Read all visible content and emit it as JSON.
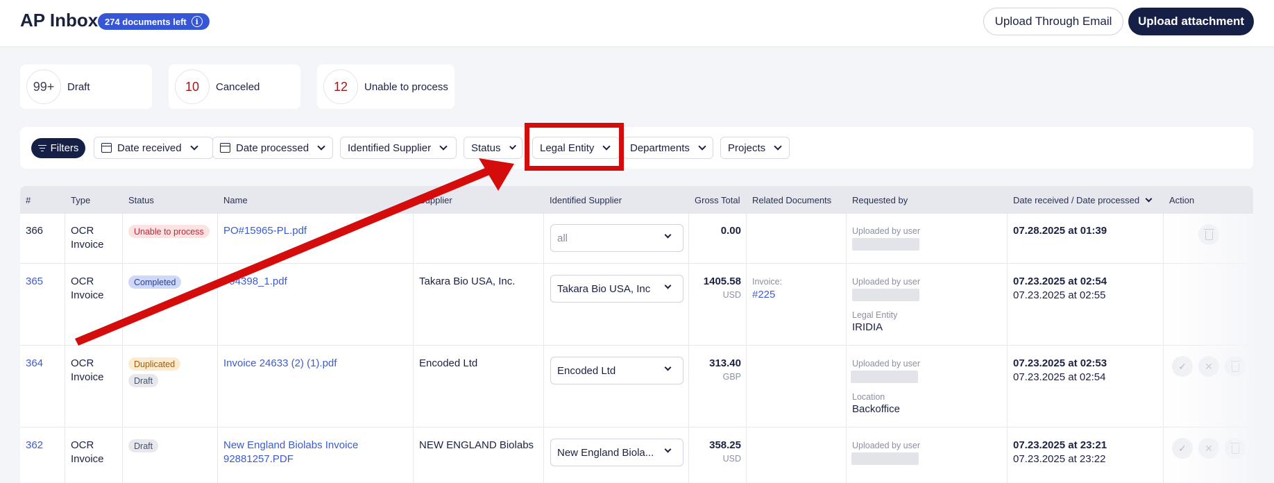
{
  "header": {
    "title": "AP Inbox",
    "docs_badge": "274 documents left",
    "upload_email_label": "Upload Through Email",
    "upload_attachment_label": "Upload attachment"
  },
  "stats": [
    {
      "count": "99+",
      "label": "Draft",
      "color": "#3b3f52"
    },
    {
      "count": "10",
      "label": "Canceled",
      "color": "#a01818"
    },
    {
      "count": "12",
      "label": "Unable to process",
      "color": "#a01818"
    }
  ],
  "filters": {
    "filters_label": "Filters",
    "date_received": "Date received",
    "date_processed": "Date processed",
    "identified_supplier": "Identified Supplier",
    "status": "Status",
    "legal_entity": "Legal Entity",
    "departments": "Departments",
    "projects": "Projects"
  },
  "table": {
    "headers": {
      "num": "#",
      "type": "Type",
      "status": "Status",
      "name": "Name",
      "supplier": "Supplier",
      "identified_supplier": "Identified Supplier",
      "gross_total": "Gross Total",
      "related": "Related Documents",
      "requested_by": "Requested by",
      "dates": "Date received / Date processed",
      "action": "Action"
    },
    "rows": [
      {
        "num": "366",
        "type": "OCR Invoice",
        "status": [
          "Unable to process"
        ],
        "name": "PO#15965-PL.pdf",
        "supplier": "",
        "identified": "all",
        "gross": "0.00",
        "currency": "",
        "related_label": "",
        "related_link": "",
        "requested": "Uploaded by user",
        "extra_label": "",
        "extra_value": "",
        "date_received": "07.28.2025 at 01:39",
        "date_processed": ""
      },
      {
        "num": "365",
        "type": "OCR Invoice",
        "status": [
          "Completed"
        ],
        "name": "794398_1.pdf",
        "supplier": "Takara Bio USA, Inc.",
        "identified": "Takara Bio USA, Inc",
        "gross": "1405.58",
        "currency": "USD",
        "related_label": "Invoice:",
        "related_link": "#225",
        "requested": "Uploaded by user",
        "extra_label": "Legal Entity",
        "extra_value": "IRIDIA",
        "date_received": "07.23.2025 at 02:54",
        "date_processed": "07.23.2025 at 02:55"
      },
      {
        "num": "364",
        "type": "OCR Invoice",
        "status": [
          "Duplicated",
          "Draft"
        ],
        "name": "Invoice 24633 (2) (1).pdf",
        "supplier": "Encoded Ltd",
        "identified": "Encoded Ltd",
        "gross": "313.40",
        "currency": "GBP",
        "related_label": "",
        "related_link": "",
        "requested": "Uploaded by user",
        "extra_label": "Location",
        "extra_value": "Backoffice",
        "date_received": "07.23.2025 at 02:53",
        "date_processed": "07.23.2025 at 02:54"
      },
      {
        "num": "362",
        "type": "OCR Invoice",
        "status": [
          "Draft"
        ],
        "name": "New England Biolabs Invoice 92881257.PDF",
        "supplier": "NEW ENGLAND Biolabs",
        "identified": "New England Biola...",
        "gross": "358.25",
        "currency": "USD",
        "related_label": "",
        "related_link": "",
        "requested": "Uploaded by user",
        "extra_label": "",
        "extra_value": "",
        "date_received": "07.23.2025 at 23:21",
        "date_processed": "07.23.2025 at 23:22"
      }
    ]
  },
  "colors": {
    "accent": "#3656d6",
    "dark": "#161f45",
    "highlight": "#d40c0c",
    "link": "#3b5bd0"
  }
}
